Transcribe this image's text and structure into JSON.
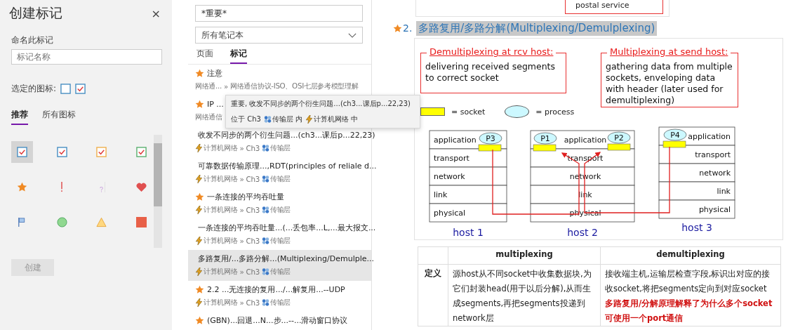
{
  "create_tag_panel": {
    "title": "创建标记",
    "close": "×",
    "name_label": "命名此标记",
    "name_placeholder": "标记名称",
    "selected_icon_label": "选定的图标:",
    "selected_icons": [
      {
        "kind": "box"
      },
      {
        "kind": "checkbox"
      }
    ],
    "tabs": [
      {
        "label": "推荐",
        "selected": true
      },
      {
        "label": "所有图标",
        "selected": false
      }
    ],
    "icon_grid": [
      {
        "kind": "checkbox",
        "selected": true
      },
      {
        "kind": "checkbox-blue",
        "selected": false
      },
      {
        "kind": "checkbox-orange",
        "selected": false
      },
      {
        "kind": "checkbox-green",
        "selected": false
      },
      {
        "kind": "star",
        "selected": false
      },
      {
        "kind": "exclamation",
        "selected": false
      },
      {
        "kind": "question",
        "selected": false
      },
      {
        "kind": "heart",
        "selected": false
      },
      {
        "kind": "flag",
        "selected": false
      },
      {
        "kind": "circle",
        "selected": false
      },
      {
        "kind": "triangle",
        "selected": false
      },
      {
        "kind": "square",
        "selected": false
      }
    ],
    "create_button": {
      "label": "创建",
      "disabled": true
    }
  },
  "search": {
    "query": "*重要*",
    "notebook_dropdown": "所有笔记本",
    "tabs": [
      {
        "label": "页面",
        "selected": false
      },
      {
        "label": "标记",
        "selected": true
      }
    ],
    "results": [
      {
        "title": "注意",
        "selected": false,
        "path": [
          {
            "kind": "plain",
            "text": "网络通..."
          },
          {
            "kind": "separator",
            "text": "»"
          },
          {
            "kind": "plain",
            "text": "网络通信协议-ISO、OSI七层参考模型理解"
          }
        ]
      },
      {
        "title": "IP ...",
        "selected": false,
        "path": [
          {
            "kind": "plain",
            "text": "网络通信"
          }
        ]
      },
      {
        "title": "收发不同步的两个衍生问题...(ch3...课后p...22,23)",
        "selected": false,
        "path": [
          {
            "kind": "notebook",
            "text": "计算机网络"
          },
          {
            "kind": "separator",
            "text": "»"
          },
          {
            "kind": "plain",
            "text": "Ch3"
          },
          {
            "kind": "section",
            "text": "传输层"
          }
        ]
      },
      {
        "title": "可靠数据传输原理...,RDT(principles of reliale d...",
        "selected": false,
        "path": [
          {
            "kind": "notebook",
            "text": "计算机网络"
          },
          {
            "kind": "separator",
            "text": "»"
          },
          {
            "kind": "plain",
            "text": "Ch3"
          },
          {
            "kind": "section",
            "text": "传输层"
          }
        ]
      },
      {
        "title": "一条连接的平均吞吐量",
        "selected": false,
        "path": [
          {
            "kind": "notebook",
            "text": "计算机网络"
          },
          {
            "kind": "separator",
            "text": "»"
          },
          {
            "kind": "plain",
            "text": "Ch3"
          },
          {
            "kind": "section",
            "text": "传输层"
          }
        ]
      },
      {
        "title": "一条连接的平均吞吐量...(...丢包率...L,...最大报文...",
        "selected": false,
        "path": [
          {
            "kind": "notebook",
            "text": "计算机网络"
          },
          {
            "kind": "separator",
            "text": "»"
          },
          {
            "kind": "plain",
            "text": "Ch3"
          },
          {
            "kind": "section",
            "text": "传输层"
          }
        ]
      },
      {
        "title": "多路复用/...多路分解...(Multiplexing/Demulple...",
        "selected": true,
        "path": [
          {
            "kind": "notebook",
            "text": "计算机网络"
          },
          {
            "kind": "separator",
            "text": "»"
          },
          {
            "kind": "plain",
            "text": "Ch3"
          },
          {
            "kind": "section",
            "text": "传输层"
          }
        ]
      },
      {
        "title": "2.2 ...无连接的复用.../...解复用...--UDP",
        "selected": false,
        "path": [
          {
            "kind": "notebook",
            "text": "计算机网络"
          },
          {
            "kind": "separator",
            "text": "»"
          },
          {
            "kind": "plain",
            "text": "Ch3"
          },
          {
            "kind": "section",
            "text": "传输层"
          }
        ]
      },
      {
        "title": "(GBN)...回退...N...步...--...滑动窗口协议",
        "selected": false
      }
    ],
    "tooltip": {
      "title": "重要, 收发不同步的两个衍生问题...(ch3...课后p...22,23)",
      "location": [
        {
          "kind": "plain",
          "text": "位于 Ch3"
        },
        {
          "kind": "section",
          "text": "传输层 内"
        },
        {
          "kind": "notebook",
          "text": "计算机网络 中"
        }
      ]
    }
  },
  "note": {
    "top_box_text": "postal service",
    "heading": {
      "starred": true,
      "number": "2.",
      "text": "多路复用/多路分解(Multiplexing/Demulplexing)"
    },
    "slide": {
      "boxes": [
        {
          "title": "Demultiplexing at rcv host:",
          "text": "delivering received segments to correct socket"
        },
        {
          "title": "Multiplexing at send host:",
          "text": "gathering data from multiple sockets, enveloping data with header (later used for demultiplexing)"
        }
      ],
      "legend": [
        {
          "kind": "socket",
          "label": "= socket"
        },
        {
          "kind": "process",
          "label": "= process"
        }
      ],
      "hosts": [
        {
          "label": "host 1",
          "layers": [
            "application",
            "transport",
            "network",
            "link",
            "physical"
          ],
          "processes": [
            "P3"
          ]
        },
        {
          "label": "host 2",
          "layers": [
            "application",
            "transport",
            "network",
            "link",
            "physical"
          ],
          "processes": [
            "P1",
            "P2"
          ]
        },
        {
          "label": "host 3",
          "layers": [
            "application",
            "transport",
            "network",
            "link",
            "physical"
          ],
          "processes": [
            "P4"
          ]
        }
      ]
    },
    "table": {
      "columns": [
        "multiplexing",
        "demultiplexing"
      ],
      "rows": [
        {
          "label": "定义",
          "cells": [
            {
              "text": "源host从不同socket中收集数据块,为它们封装head(用于以后分解),从而生成segments,再把segments投递到network层"
            },
            {
              "text": "接收端主机,运输层检查字段,标识出对应的接收socket,将把segments定向到对应socket",
              "note": "多路复用/分解原理解释了为什么多个socket可使用一个port通信"
            }
          ]
        }
      ]
    }
  }
}
